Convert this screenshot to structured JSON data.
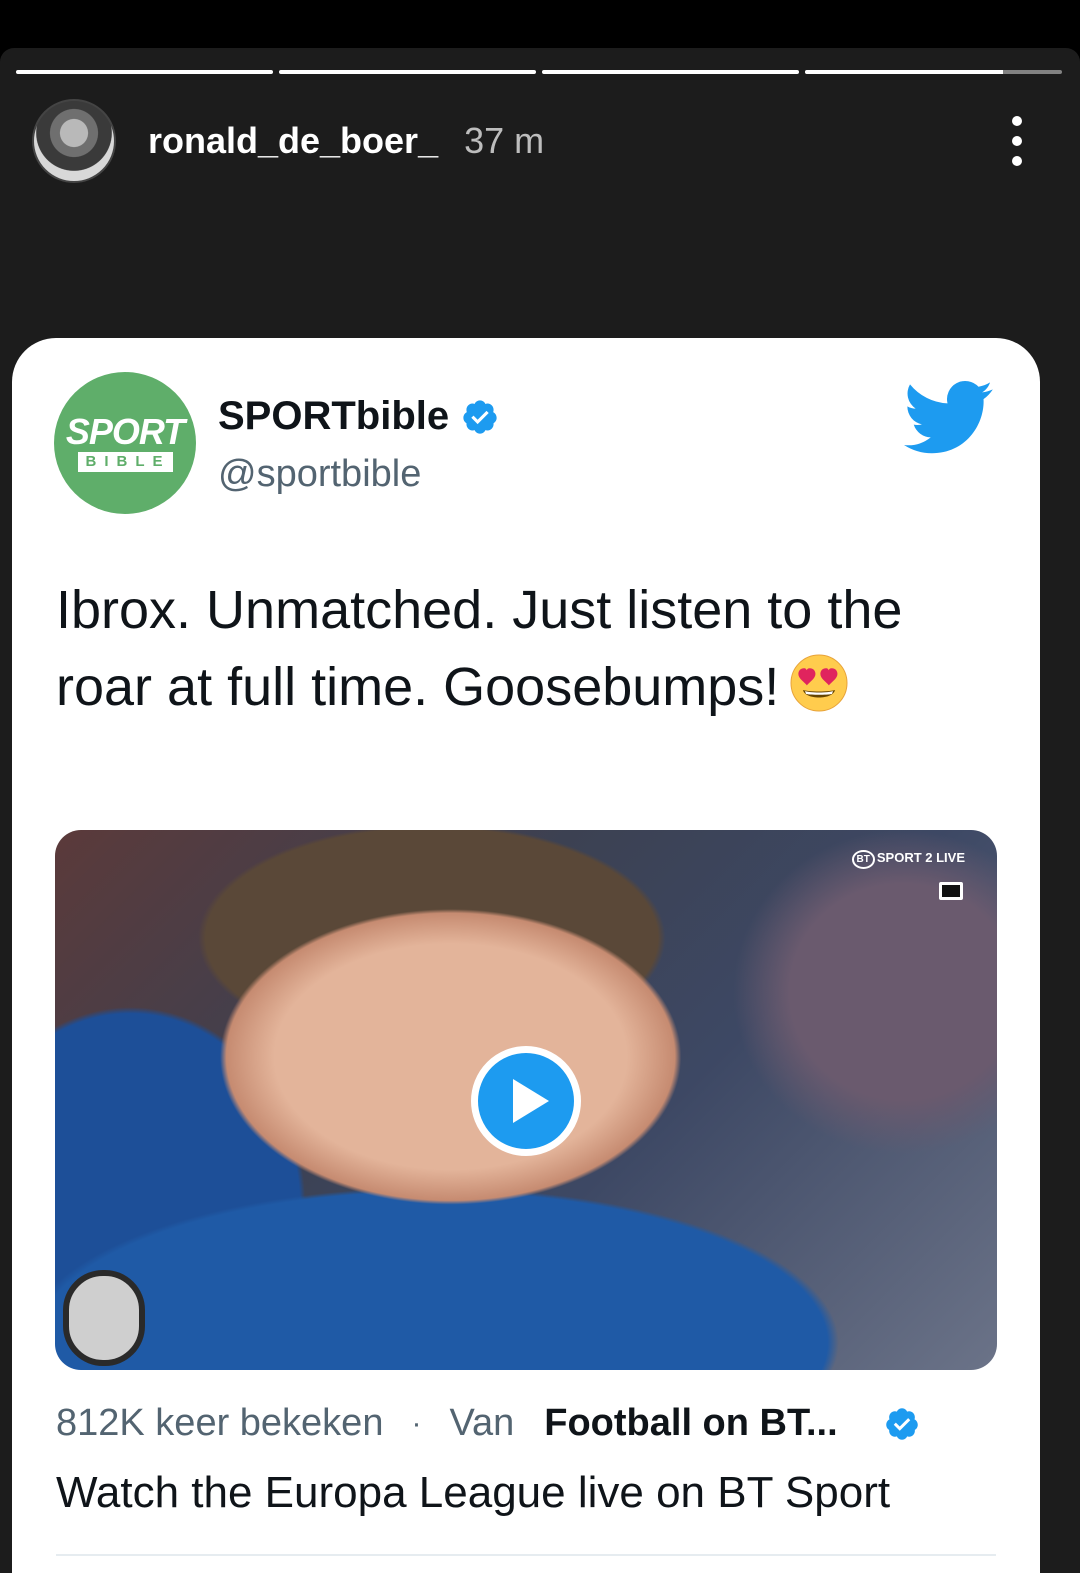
{
  "story": {
    "progress": [
      1,
      1,
      1,
      0.77
    ],
    "username": "ronald_de_boer_",
    "time": "37 m"
  },
  "tweet": {
    "logo_top": "SPORT",
    "logo_bottom": "BIBLE",
    "display_name": "SPORTbible",
    "handle": "@sportbible",
    "text": "Ibrox. Unmatched. Just listen to the roar at full time. Goosebumps!",
    "emoji": "heart-eyes-emoji",
    "video": {
      "broadcaster_badge_circle": "BT",
      "broadcaster_badge_text": "SPORT 2 LIVE"
    },
    "views": "812K keer bekeken",
    "separator": "·",
    "from_label": "Van",
    "source": "Football on BT...",
    "card_title": "Watch the Europa League live on BT Sport"
  },
  "colors": {
    "twitter_blue": "#1d9bf0",
    "sportbible_green": "#5fae6a",
    "story_bg": "#1c1c1c"
  }
}
